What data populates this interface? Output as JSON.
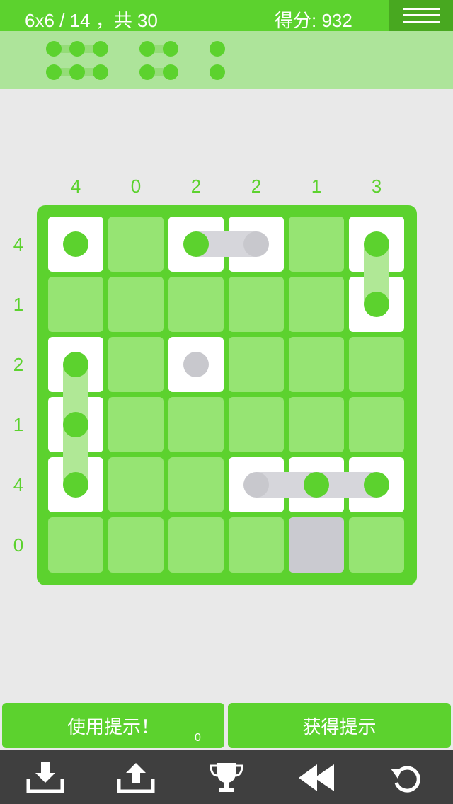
{
  "header": {
    "level_text": "6x6 / 14 ，共 30",
    "score_text": "得分: 932"
  },
  "column_clues": [
    "4",
    "0",
    "2",
    "2",
    "1",
    "3"
  ],
  "row_clues": [
    "4",
    "1",
    "2",
    "1",
    "4",
    "0"
  ],
  "buttons": {
    "use_hint_label": "使用提示！",
    "use_hint_count": "0",
    "get_hint_label": "获得提示"
  },
  "toolbar": {
    "icons": [
      "download-icon",
      "upload-icon",
      "trophy-icon",
      "rewind-icon",
      "undo-icon"
    ]
  },
  "colors": {
    "accent": "#5cd22e",
    "cell": "#96e473",
    "toolbar": "#3f3f3f"
  }
}
